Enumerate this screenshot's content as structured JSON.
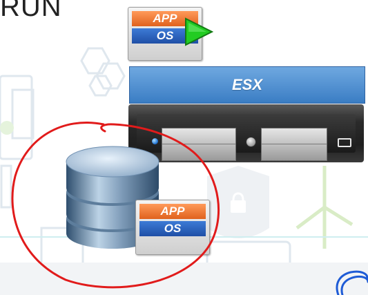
{
  "title": "RUN",
  "top_vm": {
    "app_label": "APP",
    "os_label": "OS"
  },
  "hypervisor": {
    "label": "ESX"
  },
  "db_vm": {
    "app_label": "APP",
    "os_label": "OS"
  },
  "colors": {
    "app_orange": "#e0621d",
    "os_blue": "#1f4fa6",
    "esx_blue": "#3a7dc4",
    "play_green": "#22cc22",
    "annotation_red": "#e11b1b",
    "annotation_blue": "#1e5bd6"
  },
  "icons": [
    "play-icon",
    "database-icon",
    "server-icon"
  ]
}
